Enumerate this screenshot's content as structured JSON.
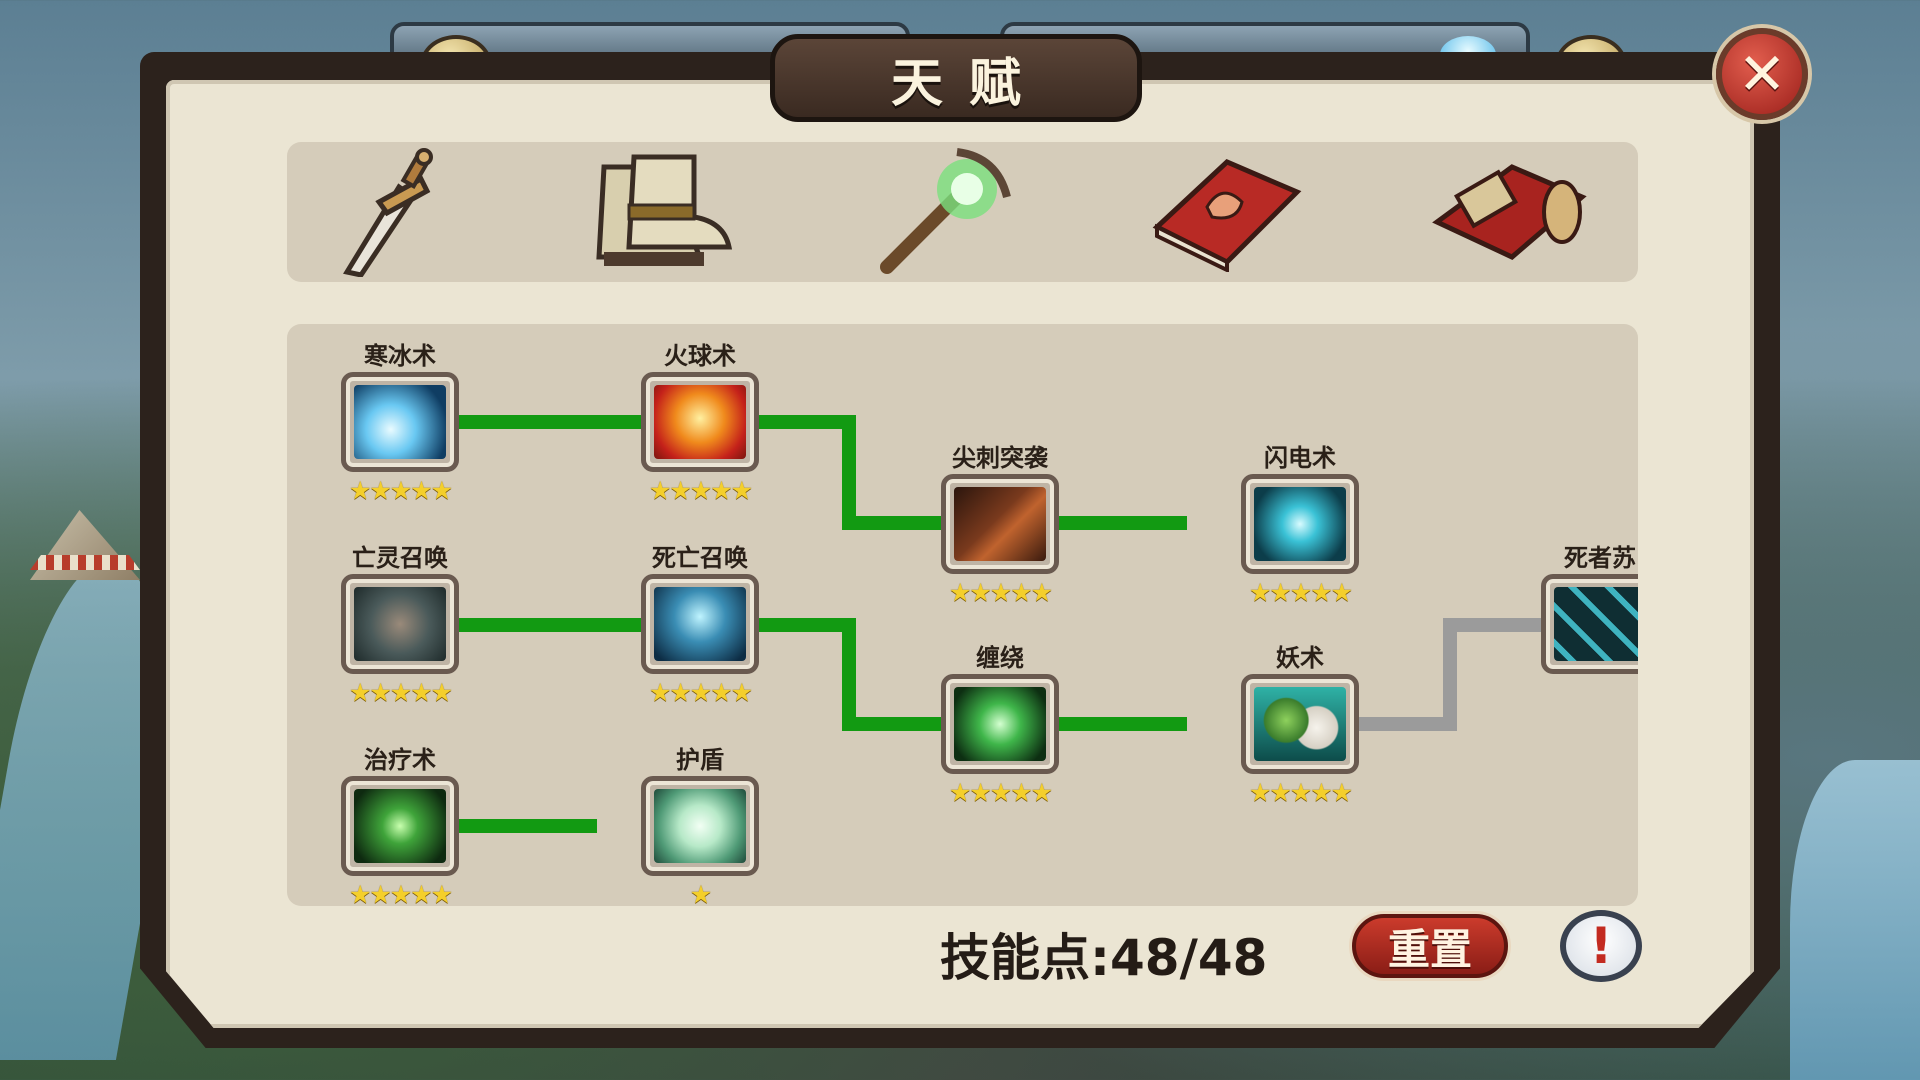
{
  "window": {
    "title": "天赋",
    "close_label": "✕"
  },
  "tabs": [
    {
      "name": "sword",
      "icon": "sword-icon"
    },
    {
      "name": "boots",
      "icon": "boots-icon"
    },
    {
      "name": "staff",
      "icon": "magic-staff-icon"
    },
    {
      "name": "strength-book",
      "icon": "strength-book-icon"
    },
    {
      "name": "spell-book",
      "icon": "spell-book-icon"
    }
  ],
  "skills": [
    {
      "id": "frost",
      "label": "寒冰术",
      "stars": "★★★★★",
      "icon": "ice-shard-icon"
    },
    {
      "id": "fireball",
      "label": "火球术",
      "stars": "★★★★★",
      "icon": "fireball-icon"
    },
    {
      "id": "spike",
      "label": "尖刺突袭",
      "stars": "★★★★★",
      "icon": "spike-icon"
    },
    {
      "id": "lightning",
      "label": "闪电术",
      "stars": "★★★★★",
      "icon": "lightning-icon"
    },
    {
      "id": "undead",
      "label": "亡灵召唤",
      "stars": "★★★★★",
      "icon": "undead-summon-icon"
    },
    {
      "id": "death",
      "label": "死亡召唤",
      "stars": "★★★★★",
      "icon": "death-summon-icon"
    },
    {
      "id": "entangle",
      "label": "缠绕",
      "stars": "★★★★★",
      "icon": "entangle-icon"
    },
    {
      "id": "hex",
      "label": "妖术",
      "stars": "★★★★★",
      "icon": "hex-icon"
    },
    {
      "id": "revive",
      "label": "死者苏",
      "stars": "",
      "icon": "locked-chain-icon"
    },
    {
      "id": "heal",
      "label": "治疗术",
      "stars": "★★★★★",
      "icon": "heal-icon"
    },
    {
      "id": "shield",
      "label": "护盾",
      "stars": "★",
      "icon": "shield-icon"
    }
  ],
  "footer": {
    "points_label": "技能点:48/48",
    "reset_label": "重置",
    "info_label": "!"
  },
  "colors": {
    "link_active": "#129a12",
    "link_locked": "#9b9b9b",
    "panel_bg": "#ebe5d3",
    "section_bg": "#d5ccba",
    "star": "#f4cf2b"
  }
}
